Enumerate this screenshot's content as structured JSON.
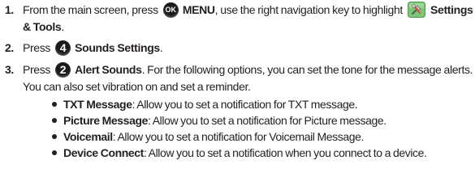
{
  "steps": [
    {
      "number": "1.",
      "text_before_icon": "From the main screen, press",
      "icon_label": "OK",
      "menu_label": "MENU",
      "text_after_menu": ", use the right navigation key to highlight",
      "settings_label": "Settings & Tools",
      "text_end": "."
    },
    {
      "number": "2.",
      "text_before_icon": "Press",
      "icon_label": "4",
      "bold_label": "Sounds Settings",
      "text_end": "."
    },
    {
      "number": "3.",
      "text_before_icon": "Press",
      "icon_label": "2",
      "bold_label": "Alert Sounds",
      "text_end": ". For the following options, you can set the tone for the message alerts. You can also set vibration on and set a reminder."
    }
  ],
  "options": [
    {
      "name": "TXT Message",
      "description": ": Allow you to set a notification for TXT message."
    },
    {
      "name": "Picture Message",
      "description": ": Allow you to set a notification for Picture message."
    },
    {
      "name": "Voicemail",
      "description": ": Allow you to set a notification for Voicemail Message."
    },
    {
      "name": "Device Connect",
      "description": ": Allow you to set a notification when you connect to a device."
    }
  ],
  "colors": {
    "text": "#231f20",
    "icon_bg": "#1a1a1a",
    "tools_icon_bg": "#7cc576"
  },
  "icons": {
    "ok_key": "ok-key-icon",
    "settings_tools": "settings-tools-icon",
    "key_4": "key-4-icon",
    "key_2": "key-2-icon"
  }
}
